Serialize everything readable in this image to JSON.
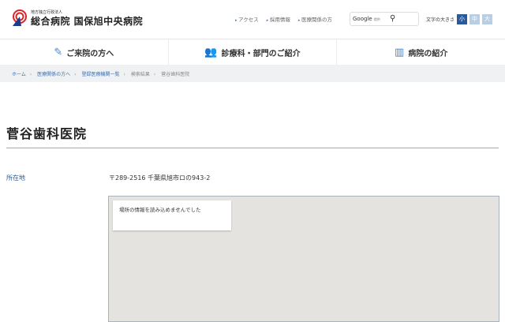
{
  "header": {
    "org_sub": "地方独立行政法人",
    "org_name": "総合病院 国保旭中央病院",
    "links": [
      "アクセス",
      "採用情報",
      "医療関係の方"
    ],
    "search": {
      "brand": "Google",
      "sub": "提供"
    },
    "font_size": {
      "label": "文字の大きさ",
      "options": [
        "小",
        "中",
        "大"
      ]
    }
  },
  "nav": [
    {
      "label": "ご来院の方へ",
      "icon": "clipboard-icon"
    },
    {
      "label": "診療科・部門のご紹介",
      "icon": "people-icon"
    },
    {
      "label": "病院の紹介",
      "icon": "building-icon"
    }
  ],
  "breadcrumb": [
    "ホーム",
    "医療関係の方へ",
    "登録医療機関一覧",
    "検索結果",
    "菅谷歯科医院"
  ],
  "page": {
    "title": "菅谷歯科医院",
    "location_label": "所在地",
    "address": "〒289-2516 千葉県旭市ロの943-2",
    "map_error": "場所の情報を読み込めませんでした"
  },
  "colors": {
    "accent": "#2a5a9a",
    "logo_red": "#d9262b"
  }
}
